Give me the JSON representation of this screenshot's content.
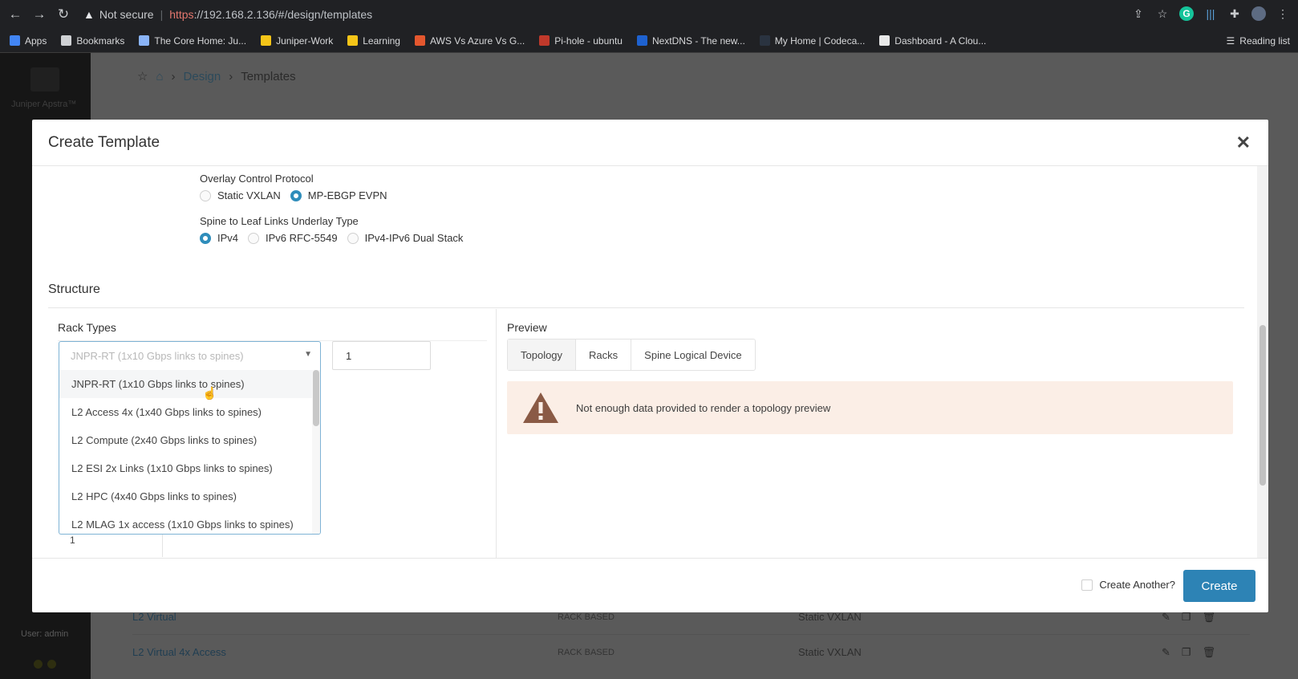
{
  "browser": {
    "not_secure": "Not secure",
    "url_https": "https",
    "url_rest": "://192.168.2.136/#/design/templates",
    "bookmarks": [
      {
        "label": "Apps",
        "color": "#4285f4"
      },
      {
        "label": "Bookmarks",
        "color": "#cfd1d4"
      },
      {
        "label": "The Core Home: Ju...",
        "color": "#8ab4f8"
      },
      {
        "label": "Juniper-Work",
        "color": "#f5c518"
      },
      {
        "label": "Learning",
        "color": "#f5c518"
      },
      {
        "label": "AWS Vs Azure Vs G...",
        "color": "#e4572e"
      },
      {
        "label": "Pi-hole - ubuntu",
        "color": "#c0392b"
      },
      {
        "label": "NextDNS - The new...",
        "color": "#1e62d0"
      },
      {
        "label": "My Home | Codeca...",
        "color": "#2a3340"
      },
      {
        "label": "Dashboard - A Clou...",
        "color": "#e8e8e8"
      }
    ],
    "reading_list": "Reading list"
  },
  "app": {
    "logo_text": "Juniper Apstra™",
    "breadcrumb": {
      "design": "Design",
      "templates": "Templates"
    },
    "user": "User: admin",
    "rows": [
      {
        "name": "L2 Virtual",
        "type": "RACK BASED",
        "overlay": "Static VXLAN"
      },
      {
        "name": "L2 Virtual 4x Access",
        "type": "RACK BASED",
        "overlay": "Static VXLAN"
      }
    ]
  },
  "modal": {
    "title": "Create Template",
    "overlay_label": "Overlay Control Protocol",
    "overlay_options": [
      "Static VXLAN",
      "MP-EBGP EVPN"
    ],
    "underlay_label": "Spine to Leaf Links Underlay Type",
    "underlay_options": [
      "IPv4",
      "IPv6 RFC-5549",
      "IPv4-IPv6 Dual Stack"
    ],
    "structure": "Structure",
    "rack_types": "Rack Types",
    "rack_select_placeholder": "JNPR-RT (1x10 Gbps links to spines)",
    "rack_count": "1",
    "dropdown_items": [
      "JNPR-RT (1x10 Gbps links to spines)",
      "L2 Access 4x (1x40 Gbps links to spines)",
      "L2 Compute (2x40 Gbps links to spines)",
      "L2 ESI 2x Links (1x10 Gbps links to spines)",
      "L2 HPC (4x40 Gbps links to spines)",
      "L2 MLAG 1x access (1x10 Gbps links to spines)"
    ],
    "stray_value": "1",
    "preview": "Preview",
    "tabs": [
      "Topology",
      "Racks",
      "Spine Logical Device"
    ],
    "warning": "Not enough data provided to render a topology preview",
    "create_another": "Create Another?",
    "create": "Create"
  },
  "colors": {
    "accent": "#2d83b5",
    "radio_on": "#2f8dbb",
    "warning_bg": "#fbeee6",
    "warning_icon": "#8a5a45"
  }
}
